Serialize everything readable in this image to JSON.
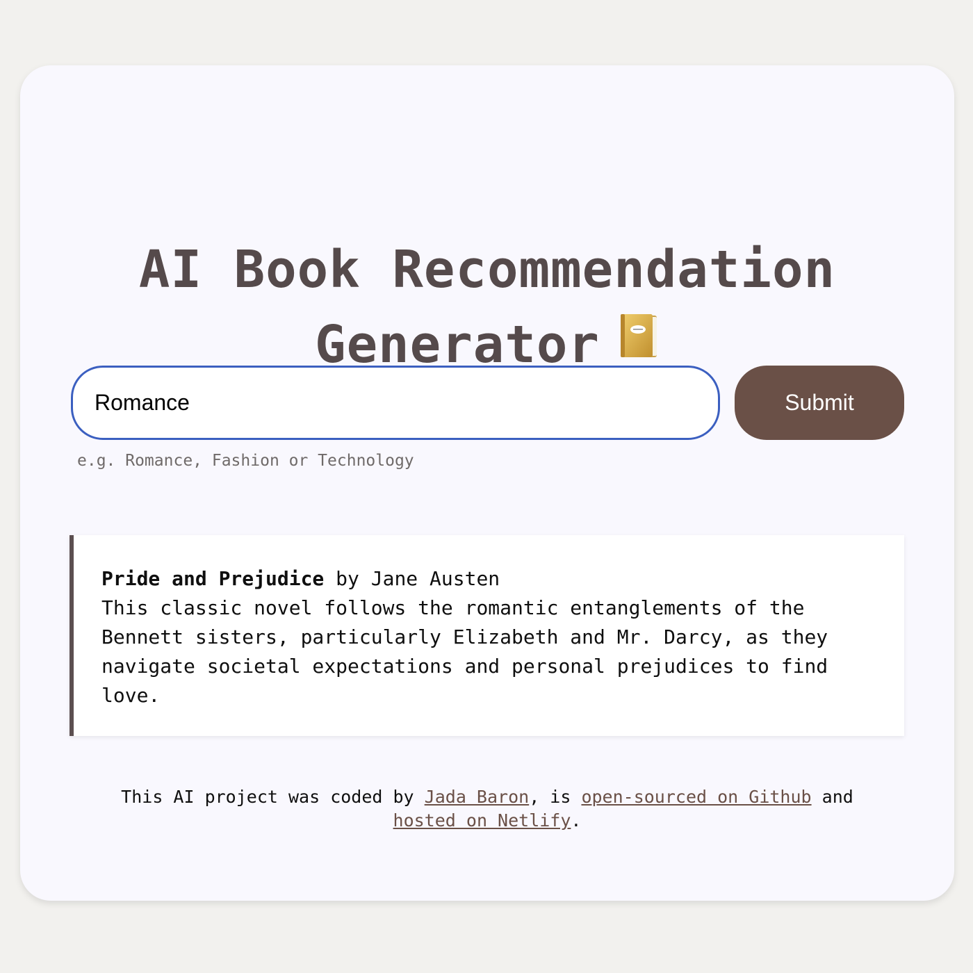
{
  "header": {
    "title_line1": "AI Book Recommendation",
    "title_line2": "Generator"
  },
  "icons": {
    "title_icon": "notebook-book-icon"
  },
  "colors": {
    "accent": "#6a5047",
    "title": "#554a4b",
    "input_border": "#3b5fc0",
    "card_background": "#f9f8fe",
    "page_background": "#f2f1ee"
  },
  "search": {
    "value": "Romance",
    "hint": "e.g. Romance, Fashion or Technology",
    "submit_label": "Submit"
  },
  "result": {
    "book_title": "Pride and Prejudice",
    "by_author": " by Jane Austen",
    "description": "This classic novel follows the romantic entanglements of the Bennett sisters, particularly Elizabeth and Mr. Darcy, as they navigate societal expectations and personal prejudices to find love."
  },
  "footer": {
    "text_before": "This AI project was coded by ",
    "author_link": "Jada Baron",
    "text_middle": ", is ",
    "github_link": "open-sourced on Github",
    "text_and": " and",
    "netlify_link": "hosted on Netlify",
    "text_end": "."
  }
}
